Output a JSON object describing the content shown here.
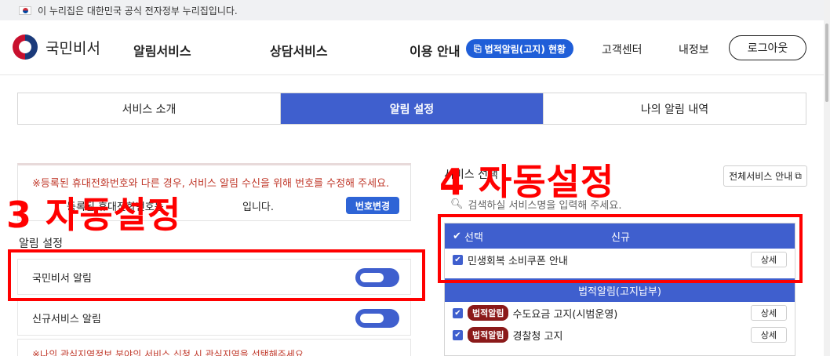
{
  "gov_bar": {
    "text": "이 누리집은 대한민국 공식 전자정부 누리집입니다."
  },
  "header": {
    "logo_text": "국민비서",
    "nav": [
      "알림서비스",
      "상담서비스",
      "이용 안내"
    ],
    "notice_pill": "법적알림(고지) 현황",
    "customer_center": "고객센터",
    "my_info": "내정보",
    "logout": "로그아웃"
  },
  "tabs": [
    {
      "label": "서비스 소개",
      "active": false
    },
    {
      "label": "알림 설정",
      "active": true
    },
    {
      "label": "나의 알림 내역",
      "active": false
    }
  ],
  "left": {
    "warning": "※등록된 휴대전화번호와 다른 경우, 서비스 알림 수신을 위해 번호를 수정해 주세요.",
    "phone_prefix": "등록된 휴대전화번호는",
    "phone_suffix": "입니다.",
    "change_button": "번호변경",
    "section_title": "알림 설정",
    "toggles": [
      {
        "label": "국민비서 알림",
        "on": true
      },
      {
        "label": "신규서비스 알림",
        "on": true
      }
    ],
    "bottom_warning": "※나의 관심지역정보 분야의 서비스 신청 시 관심지역을 선택해주세요."
  },
  "right": {
    "title": "서비스 선택",
    "all_service_button": "전체서비스 안내",
    "search_placeholder": "검색하실 서비스명을 입력해 주세요.",
    "list_header_select": "선택",
    "list_header_new": "신규",
    "new_services": [
      {
        "name": "민생회복 소비쿠폰 안내",
        "detail": "상세"
      }
    ],
    "category": "법적알림(고지납부)",
    "legal_services": [
      {
        "tag": "법적알림",
        "name": "수도요금 고지(시범운영)",
        "detail": "상세"
      },
      {
        "tag": "법적알림",
        "name": "경찰청 고지",
        "detail": "상세"
      }
    ]
  },
  "annotations": {
    "label_3": "3 자동설정",
    "label_4": "4 자동설정"
  },
  "colors": {
    "accent": "#3f5fce",
    "pill": "#1f5ed8",
    "annotation": "#ff0000",
    "legal_tag": "#8b1a1a"
  }
}
